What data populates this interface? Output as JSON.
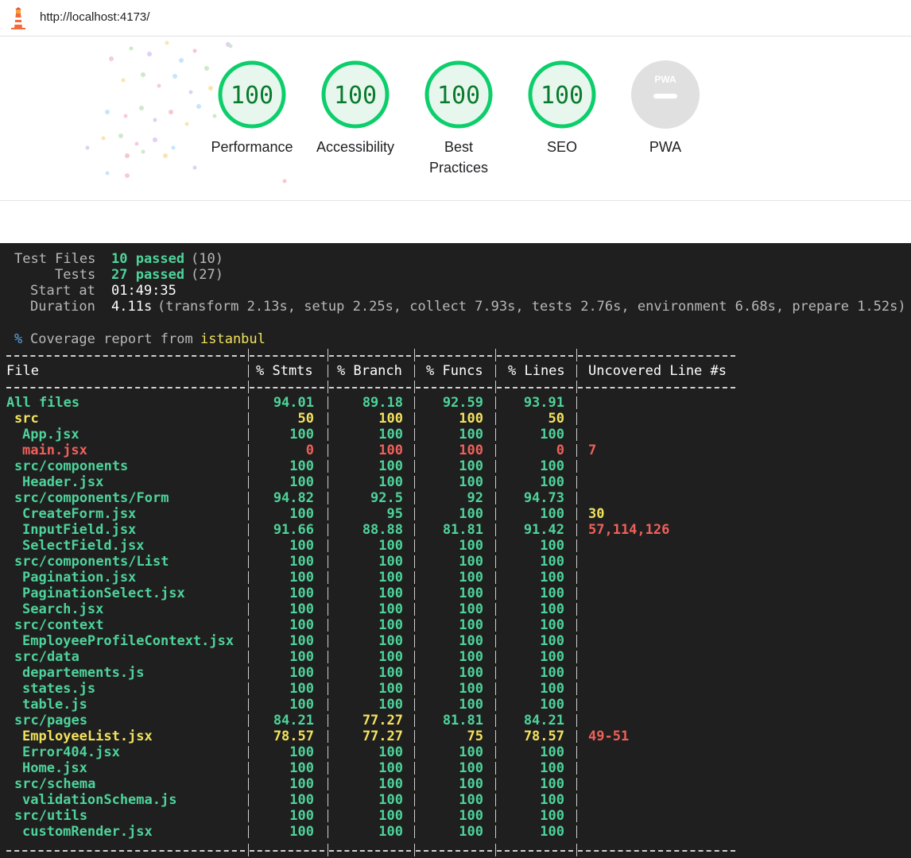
{
  "browser": {
    "url": "http://localhost:4173/",
    "icon": "lighthouse-icon"
  },
  "scores": [
    {
      "label": "Performance",
      "score": "100",
      "kind": "score"
    },
    {
      "label": "Accessibility",
      "score": "100",
      "kind": "score"
    },
    {
      "label": "Best Practices",
      "score": "100",
      "kind": "score"
    },
    {
      "label": "SEO",
      "score": "100",
      "kind": "score"
    },
    {
      "label": "PWA",
      "score": "",
      "kind": "pwa",
      "badge_text": "PWA"
    }
  ],
  "colors": {
    "pass": "#0cce6b",
    "terminal_bg": "#1f1f1f",
    "green": "#4ed39a",
    "yellow": "#f2e35c",
    "red": "#f0605a"
  },
  "summary": {
    "test_files_label": "Test Files",
    "test_files_value": "10 passed",
    "test_files_total": "(10)",
    "tests_label": "Tests",
    "tests_value": "27 passed",
    "tests_total": "(27)",
    "start_label": "Start at",
    "start_value": "01:49:35",
    "duration_label": "Duration",
    "duration_value": "4.11s",
    "duration_detail": "(transform 2.13s, setup 2.25s, collect 7.93s, tests 2.76s, environment 6.68s, prepare 1.52s)"
  },
  "coverage": {
    "heading_prefix": "%",
    "heading_text": "Coverage report from",
    "provider": "istanbul",
    "headers": [
      "File",
      "% Stmts",
      "% Branch",
      "% Funcs",
      "% Lines",
      "Uncovered Line #s"
    ],
    "rows": [
      {
        "name": "All files",
        "indent": 0,
        "stmts": "94.01",
        "branch": "89.18",
        "funcs": "92.59",
        "lines": "93.91",
        "uncovered": "",
        "level": "high"
      },
      {
        "name": "src",
        "indent": 1,
        "stmts": "50",
        "branch": "100",
        "funcs": "100",
        "lines": "50",
        "uncovered": "",
        "level": "medium"
      },
      {
        "name": "App.jsx",
        "indent": 2,
        "stmts": "100",
        "branch": "100",
        "funcs": "100",
        "lines": "100",
        "uncovered": "",
        "level": "high"
      },
      {
        "name": "main.jsx",
        "indent": 2,
        "stmts": "0",
        "branch": "100",
        "funcs": "100",
        "lines": "0",
        "uncovered": "7",
        "level": "low"
      },
      {
        "name": "src/components",
        "indent": 1,
        "stmts": "100",
        "branch": "100",
        "funcs": "100",
        "lines": "100",
        "uncovered": "",
        "level": "high"
      },
      {
        "name": "Header.jsx",
        "indent": 2,
        "stmts": "100",
        "branch": "100",
        "funcs": "100",
        "lines": "100",
        "uncovered": "",
        "level": "high"
      },
      {
        "name": "src/components/Form",
        "indent": 1,
        "stmts": "94.82",
        "branch": "92.5",
        "funcs": "92",
        "lines": "94.73",
        "uncovered": "",
        "level": "high"
      },
      {
        "name": "CreateForm.jsx",
        "indent": 2,
        "stmts": "100",
        "branch": "95",
        "funcs": "100",
        "lines": "100",
        "uncovered": "30",
        "level": "high",
        "uncovered_level": "medium"
      },
      {
        "name": "InputField.jsx",
        "indent": 2,
        "stmts": "91.66",
        "branch": "88.88",
        "funcs": "81.81",
        "lines": "91.42",
        "uncovered": "57,114,126",
        "level": "high",
        "uncovered_level": "low"
      },
      {
        "name": "SelectField.jsx",
        "indent": 2,
        "stmts": "100",
        "branch": "100",
        "funcs": "100",
        "lines": "100",
        "uncovered": "",
        "level": "high"
      },
      {
        "name": "src/components/List",
        "indent": 1,
        "stmts": "100",
        "branch": "100",
        "funcs": "100",
        "lines": "100",
        "uncovered": "",
        "level": "high"
      },
      {
        "name": "Pagination.jsx",
        "indent": 2,
        "stmts": "100",
        "branch": "100",
        "funcs": "100",
        "lines": "100",
        "uncovered": "",
        "level": "high"
      },
      {
        "name": "PaginationSelect.jsx",
        "indent": 2,
        "stmts": "100",
        "branch": "100",
        "funcs": "100",
        "lines": "100",
        "uncovered": "",
        "level": "high"
      },
      {
        "name": "Search.jsx",
        "indent": 2,
        "stmts": "100",
        "branch": "100",
        "funcs": "100",
        "lines": "100",
        "uncovered": "",
        "level": "high"
      },
      {
        "name": "src/context",
        "indent": 1,
        "stmts": "100",
        "branch": "100",
        "funcs": "100",
        "lines": "100",
        "uncovered": "",
        "level": "high"
      },
      {
        "name": "EmployeeProfileContext.jsx",
        "indent": 2,
        "stmts": "100",
        "branch": "100",
        "funcs": "100",
        "lines": "100",
        "uncovered": "",
        "level": "high"
      },
      {
        "name": "src/data",
        "indent": 1,
        "stmts": "100",
        "branch": "100",
        "funcs": "100",
        "lines": "100",
        "uncovered": "",
        "level": "high"
      },
      {
        "name": "departements.js",
        "indent": 2,
        "stmts": "100",
        "branch": "100",
        "funcs": "100",
        "lines": "100",
        "uncovered": "",
        "level": "high"
      },
      {
        "name": "states.js",
        "indent": 2,
        "stmts": "100",
        "branch": "100",
        "funcs": "100",
        "lines": "100",
        "uncovered": "",
        "level": "high"
      },
      {
        "name": "table.js",
        "indent": 2,
        "stmts": "100",
        "branch": "100",
        "funcs": "100",
        "lines": "100",
        "uncovered": "",
        "level": "high"
      },
      {
        "name": "src/pages",
        "indent": 1,
        "stmts": "84.21",
        "branch": "77.27",
        "funcs": "81.81",
        "lines": "84.21",
        "uncovered": "",
        "level": "high",
        "branch_level": "medium"
      },
      {
        "name": "EmployeeList.jsx",
        "indent": 2,
        "stmts": "78.57",
        "branch": "77.27",
        "funcs": "75",
        "lines": "78.57",
        "uncovered": "49-51",
        "level": "medium",
        "uncovered_level": "low"
      },
      {
        "name": "Error404.jsx",
        "indent": 2,
        "stmts": "100",
        "branch": "100",
        "funcs": "100",
        "lines": "100",
        "uncovered": "",
        "level": "high"
      },
      {
        "name": "Home.jsx",
        "indent": 2,
        "stmts": "100",
        "branch": "100",
        "funcs": "100",
        "lines": "100",
        "uncovered": "",
        "level": "high"
      },
      {
        "name": "src/schema",
        "indent": 1,
        "stmts": "100",
        "branch": "100",
        "funcs": "100",
        "lines": "100",
        "uncovered": "",
        "level": "high"
      },
      {
        "name": "validationSchema.js",
        "indent": 2,
        "stmts": "100",
        "branch": "100",
        "funcs": "100",
        "lines": "100",
        "uncovered": "",
        "level": "high"
      },
      {
        "name": "src/utils",
        "indent": 1,
        "stmts": "100",
        "branch": "100",
        "funcs": "100",
        "lines": "100",
        "uncovered": "",
        "level": "high"
      },
      {
        "name": "customRender.jsx",
        "indent": 2,
        "stmts": "100",
        "branch": "100",
        "funcs": "100",
        "lines": "100",
        "uncovered": "",
        "level": "high"
      }
    ]
  }
}
